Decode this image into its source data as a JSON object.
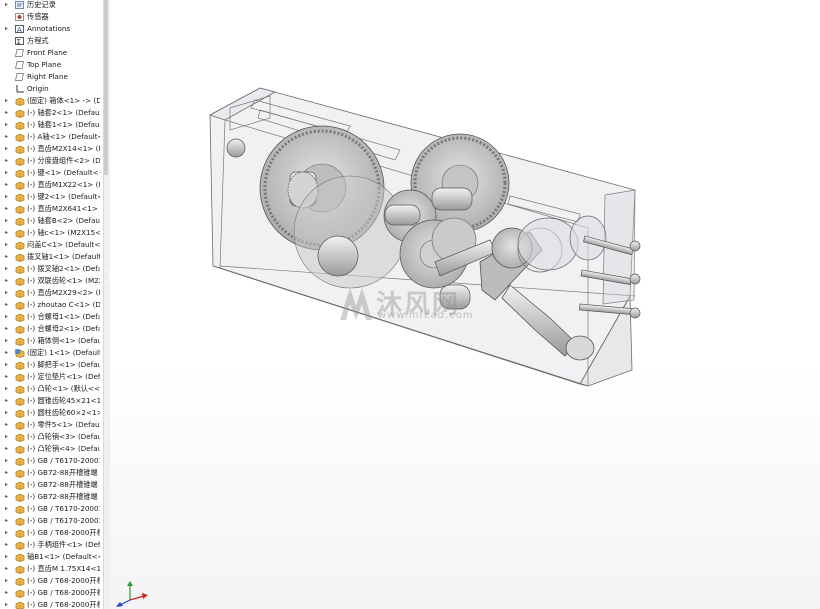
{
  "tree": {
    "items": [
      {
        "label": "历史记录",
        "icon": "history-icon",
        "expand": true
      },
      {
        "label": "传感器",
        "icon": "sensor-icon",
        "expand": false
      },
      {
        "label": "Annotations",
        "icon": "annotations-icon",
        "expand": true
      },
      {
        "label": "方程式",
        "icon": "equation-icon",
        "expand": false
      },
      {
        "label": "Front Plane",
        "icon": "plane-icon",
        "expand": false
      },
      {
        "label": "Top Plane",
        "icon": "plane-icon",
        "expand": false
      },
      {
        "label": "Right Plane",
        "icon": "plane-icon",
        "expand": false
      },
      {
        "label": "Origin",
        "icon": "origin-icon",
        "expand": false
      },
      {
        "label": "(固定) 箱体<1> -> (De",
        "icon": "part-icon",
        "expand": true
      },
      {
        "label": "(-) 轴套2<1> (Default",
        "icon": "part-icon",
        "expand": true
      },
      {
        "label": "(-) 轴套1<1> (Default-",
        "icon": "part-icon",
        "expand": true
      },
      {
        "label": "(-) A轴<1> (Default<<",
        "icon": "part-icon",
        "expand": true
      },
      {
        "label": "(-) 直齿M2X14<1> (M",
        "icon": "part-icon",
        "expand": true
      },
      {
        "label": "(-) 分度盘组件<2> (De",
        "icon": "part-icon",
        "expand": true
      },
      {
        "label": "(-) 键<1> (Default<<D",
        "icon": "part-icon",
        "expand": true
      },
      {
        "label": "(-) 直齿M1X22<1> (M",
        "icon": "part-icon",
        "expand": true
      },
      {
        "label": "(-) 键2<1> (Default<<",
        "icon": "part-icon",
        "expand": true
      },
      {
        "label": "(-) 直齿M2X641<1> (M",
        "icon": "part-icon",
        "expand": true
      },
      {
        "label": "(-) 轴套B<2> (Default-",
        "icon": "part-icon",
        "expand": true
      },
      {
        "label": "(-) 轴c<1> (M2X15<<",
        "icon": "part-icon",
        "expand": true
      },
      {
        "label": "闷盖C<1> (Default<<D",
        "icon": "part-icon",
        "expand": true
      },
      {
        "label": "拨叉轴1<1> (Default<",
        "icon": "part-icon",
        "expand": true
      },
      {
        "label": "(-) 拨叉轴2<1> (Defau",
        "icon": "part-icon",
        "expand": true
      },
      {
        "label": "(-) 双联齿轮<1> (M2X",
        "icon": "part-icon",
        "expand": true
      },
      {
        "label": "(-) 直齿M2X29<2> (M",
        "icon": "part-icon",
        "expand": true
      },
      {
        "label": "(-) zhoutao C<1> (Def",
        "icon": "part-icon",
        "expand": true
      },
      {
        "label": "(-) 合螺母1<1> (Defau",
        "icon": "part-icon",
        "expand": true
      },
      {
        "label": "(-) 合螺母2<1> (Defau",
        "icon": "part-icon",
        "expand": true
      },
      {
        "label": "(-) 箱体侧<1> (Default",
        "icon": "part-icon",
        "expand": true
      },
      {
        "label": "(固定) 1<1> (Default<",
        "icon": "assembly-icon",
        "expand": true
      },
      {
        "label": "(-) 脚把手<1> (Default",
        "icon": "part-icon",
        "expand": true
      },
      {
        "label": "(-) 定位垫片<1> (Defau",
        "icon": "part-icon",
        "expand": true
      },
      {
        "label": "(-) 凸轮<1> (默认<<默",
        "icon": "part-icon",
        "expand": true
      },
      {
        "label": "(-) 圆锥齿轮45×21<1>",
        "icon": "part-icon",
        "expand": true
      },
      {
        "label": "(-) 圆柱齿轮60×2<1> (",
        "icon": "part-icon",
        "expand": true
      },
      {
        "label": "(-) 零件5<1> (Default-",
        "icon": "part-icon",
        "expand": true
      },
      {
        "label": "(-) 凸轮销<3> (Defaul",
        "icon": "part-icon",
        "expand": true
      },
      {
        "label": "(-) 凸轮销<4> (Defaul",
        "icon": "part-icon",
        "expand": true
      },
      {
        "label": "(-) GB / T6170-20001",
        "icon": "part-icon",
        "expand": true
      },
      {
        "label": "(-) GB72-88开槽锥端",
        "icon": "part-icon",
        "expand": true
      },
      {
        "label": "(-) GB72-88开槽锥端",
        "icon": "part-icon",
        "expand": true
      },
      {
        "label": "(-) GB72-88开槽锥端",
        "icon": "part-icon",
        "expand": true
      },
      {
        "label": "(-) GB / T6170-20001",
        "icon": "part-icon",
        "expand": true
      },
      {
        "label": "(-) GB / T6170-20001",
        "icon": "part-icon",
        "expand": true
      },
      {
        "label": "(-) GB / T68-2000开槽",
        "icon": "part-icon",
        "expand": true
      },
      {
        "label": "(-) 手柄组件<1> (Defau",
        "icon": "part-icon",
        "expand": true
      },
      {
        "label": "轴B1<1> (Default<<D",
        "icon": "part-icon",
        "expand": true
      },
      {
        "label": "(-) 直齿M 1.75X14<1>",
        "icon": "part-icon",
        "expand": true
      },
      {
        "label": "(-) GB / T68-2000开槽",
        "icon": "part-icon",
        "expand": true
      },
      {
        "label": "(-) GB / T68-2000开槽",
        "icon": "part-icon",
        "expand": true
      },
      {
        "label": "(-) GB / T68-2000开槽",
        "icon": "part-icon",
        "expand": true
      }
    ]
  },
  "watermark": {
    "text": "沐风网",
    "url": "www.mfcad.com"
  },
  "colors": {
    "part_icon": "#e8b64a",
    "model_edge": "#5a5a5a",
    "gear_fill": "#c8c8c8",
    "body_fill": "#e6e6e8"
  }
}
